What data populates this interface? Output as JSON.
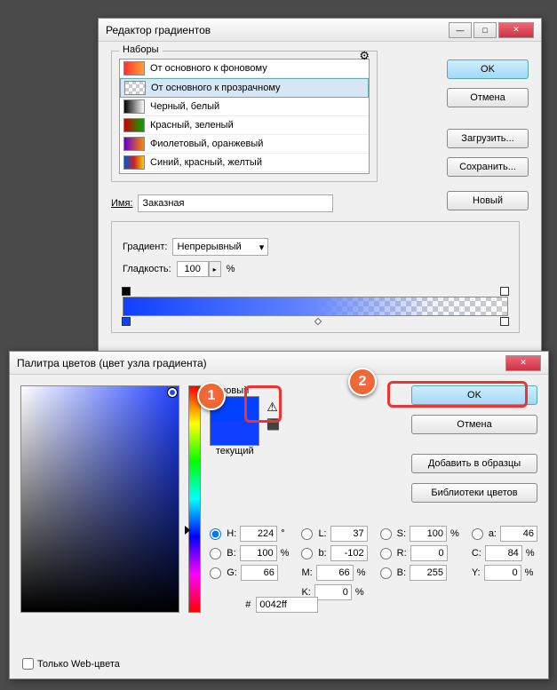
{
  "gradient_editor": {
    "title": "Редактор градиентов",
    "presets_label": "Наборы",
    "presets": [
      {
        "label": "От основного к фоновому",
        "g": "linear-gradient(90deg,#f33,#ffa030)"
      },
      {
        "label": "От основного к прозрачному",
        "g": "repeating-conic-gradient(#ccc 0% 25%,#fff 0% 50%) 0/8px 8px"
      },
      {
        "label": "Черный, белый",
        "g": "linear-gradient(90deg,#000,#fff)"
      },
      {
        "label": "Красный, зеленый",
        "g": "linear-gradient(90deg,#c00,#0a0)"
      },
      {
        "label": "Фиолетовый, оранжевый",
        "g": "linear-gradient(90deg,#60c,#f80)"
      },
      {
        "label": "Синий, красный, желтый",
        "g": "linear-gradient(90deg,#05c,#c22,#fc0)"
      }
    ],
    "ok": "OK",
    "cancel": "Отмена",
    "load": "Загрузить...",
    "save": "Сохранить...",
    "name_label": "Имя:",
    "name_value": "Заказная",
    "new_btn": "Новый",
    "gradient_type_label": "Градиент:",
    "gradient_type_value": "Непрерывный",
    "smoothness_label": "Гладкость:",
    "smoothness_value": "100",
    "percent": "%"
  },
  "color_picker": {
    "title": "Палитра цветов (цвет узла градиента)",
    "new_label": "новый",
    "current_label": "текущий",
    "ok": "OK",
    "cancel": "Отмена",
    "add_swatch": "Добавить в образцы",
    "color_libs": "Библиотеки цветов",
    "web_only": "Только Web-цвета",
    "H": "224",
    "S": "100",
    "Bv": "100",
    "R": "0",
    "G": "66",
    "Bc": "255",
    "L": "37",
    "a": "46",
    "b": "-102",
    "C": "84",
    "M": "66",
    "Y": "0",
    "K": "0",
    "deg": "°",
    "pct": "%",
    "hex_label": "#",
    "hex": "0042ff",
    "labels": {
      "H": "H:",
      "S": "S:",
      "B": "B:",
      "R": "R:",
      "G": "G:",
      "Bc": "B:",
      "L": "L:",
      "a": "a:",
      "b": "b:",
      "C": "C:",
      "M": "M:",
      "Y": "Y:",
      "K": "K:"
    },
    "new_color": "#0042ff",
    "cur_color": "#1040ff"
  },
  "callouts": {
    "one": "1",
    "two": "2"
  }
}
